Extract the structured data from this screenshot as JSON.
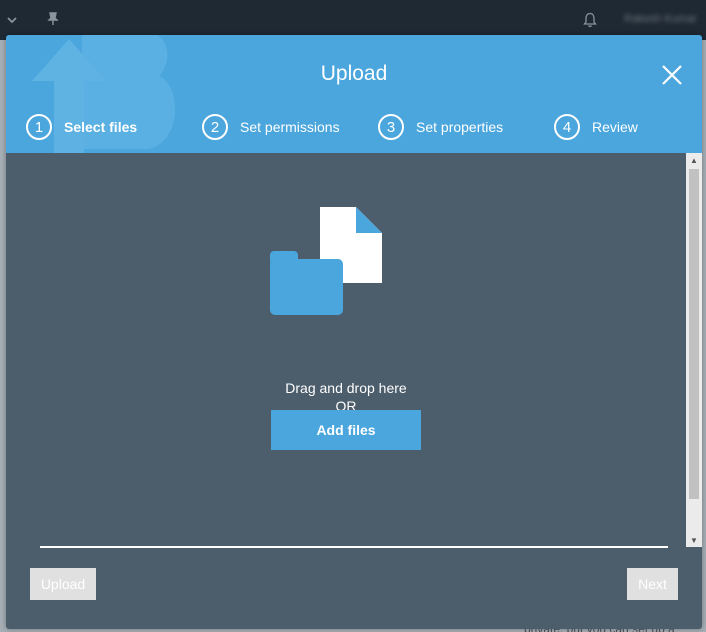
{
  "background": {
    "user_name": "Rakesh Kumar",
    "page_text": "private, but you can set up a"
  },
  "modal": {
    "title": "Upload",
    "steps": [
      {
        "number": "1",
        "label": "Select files",
        "active": true
      },
      {
        "number": "2",
        "label": "Set permissions",
        "active": false
      },
      {
        "number": "3",
        "label": "Set properties",
        "active": false
      },
      {
        "number": "4",
        "label": "Review",
        "active": false
      }
    ],
    "drop": {
      "line1": "Drag and drop here",
      "line2": "OR",
      "add_files_label": "Add files"
    },
    "footer": {
      "upload_label": "Upload",
      "next_label": "Next"
    }
  },
  "colors": {
    "accent": "#4aa6dd",
    "modal_body": "#4c5d6b",
    "disabled_button": "#e0e0e0"
  },
  "icons": [
    "chevron-down-icon",
    "pin-icon",
    "bell-icon",
    "close-icon",
    "folder-icon",
    "file-icon",
    "upload-logo-icon"
  ]
}
